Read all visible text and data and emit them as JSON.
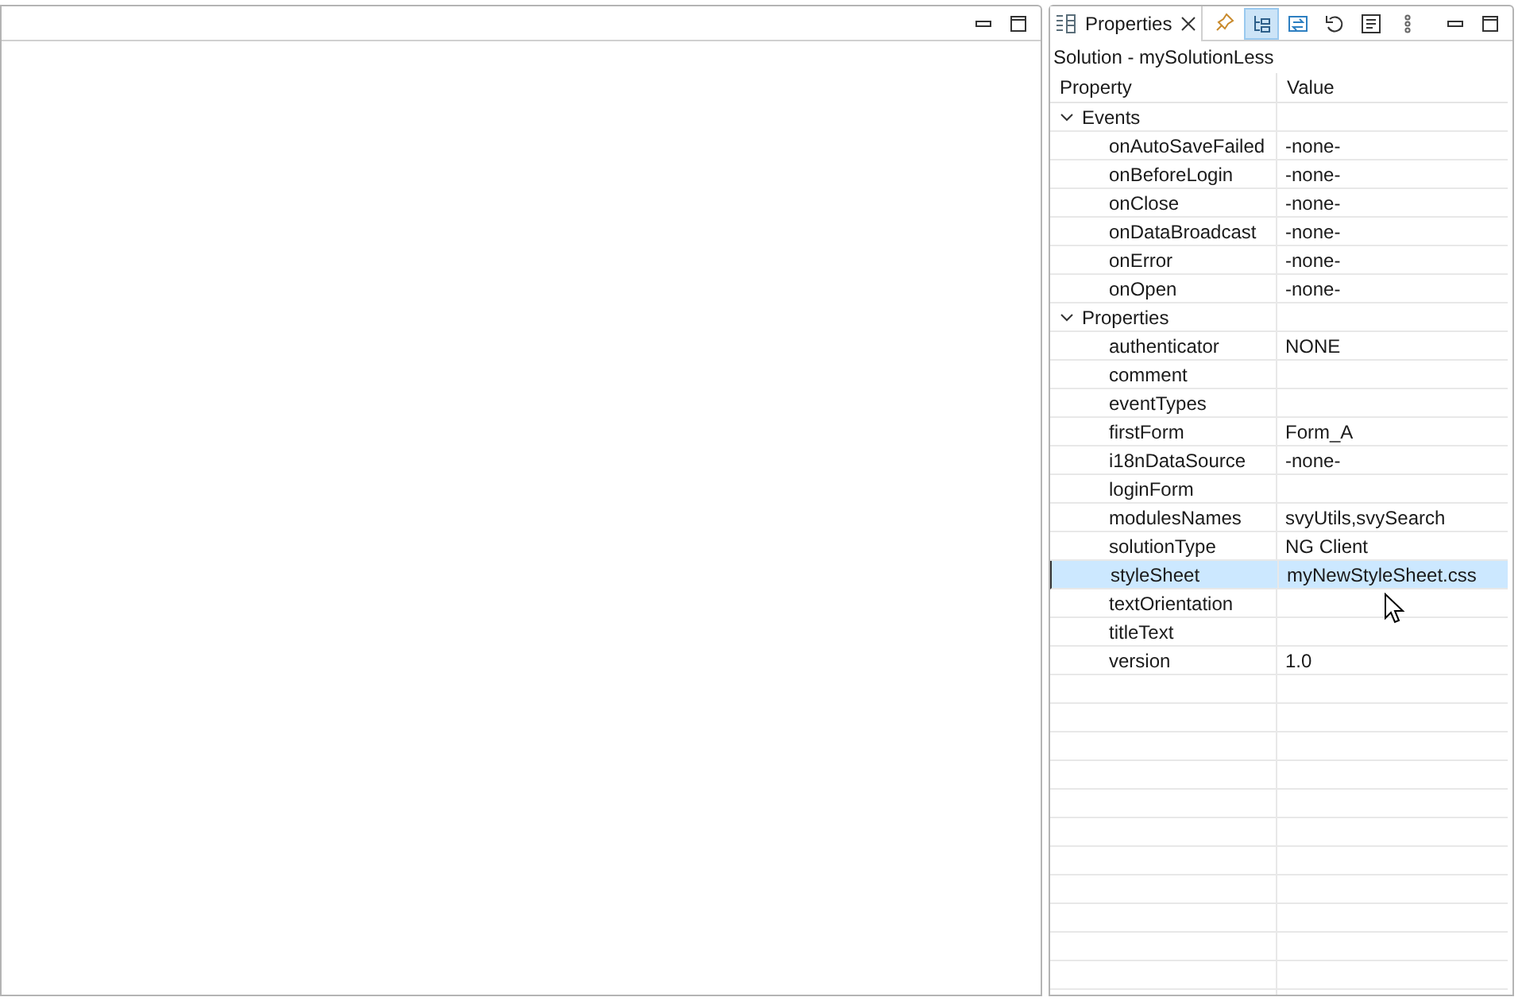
{
  "properties_view": {
    "tab": {
      "label": "Properties",
      "selected": true
    },
    "toolbar": [
      {
        "kind": "pin",
        "selected": false
      },
      {
        "kind": "tree",
        "selected": true
      },
      {
        "kind": "link",
        "selected": false
      },
      {
        "kind": "undo",
        "selected": false
      },
      {
        "kind": "doc",
        "selected": false
      },
      {
        "kind": "more",
        "selected": false
      }
    ],
    "subtitle": "Solution - mySolutionLess",
    "columns": [
      "Property",
      "Value"
    ],
    "groups": [
      {
        "label": "Events",
        "expanded": true,
        "children": [
          {
            "name": "onAutoSaveFailed",
            "value": "-none-",
            "selected": false
          },
          {
            "name": "onBeforeLogin",
            "value": "-none-",
            "selected": false
          },
          {
            "name": "onClose",
            "value": "-none-",
            "selected": false
          },
          {
            "name": "onDataBroadcast",
            "value": "-none-",
            "selected": false
          },
          {
            "name": "onError",
            "value": "-none-",
            "selected": false
          },
          {
            "name": "onOpen",
            "value": "-none-",
            "selected": false
          }
        ]
      },
      {
        "label": "Properties",
        "expanded": true,
        "children": [
          {
            "name": "authenticator",
            "value": "NONE",
            "selected": false
          },
          {
            "name": "comment",
            "selected": false
          },
          {
            "name": "eventTypes",
            "selected": false
          },
          {
            "name": "firstForm",
            "value": "Form_A",
            "selected": false
          },
          {
            "name": "i18nDataSource",
            "value": "-none-",
            "selected": false
          },
          {
            "name": "loginForm",
            "selected": false
          },
          {
            "name": "modulesNames",
            "value": "svyUtils,svySearch",
            "selected": false
          },
          {
            "name": "solutionType",
            "value": "NG Client",
            "selected": false
          },
          {
            "name": "styleSheet",
            "value": "myNewStyleSheet.css",
            "selected": true
          },
          {
            "name": "textOrientation",
            "selected": false
          },
          {
            "name": "titleText",
            "selected": false
          },
          {
            "name": "version",
            "value": "1.0",
            "selected": false
          }
        ]
      }
    ]
  }
}
